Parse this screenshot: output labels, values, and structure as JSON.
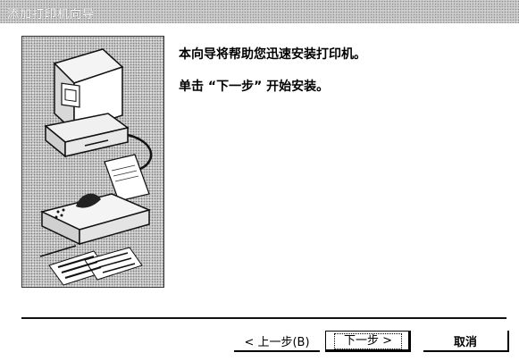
{
  "window": {
    "title": "添加打印机向导"
  },
  "content": {
    "line1": "本向导将帮助您迅速安装打印机。",
    "line2": "单击 “下一步” 开始安装。"
  },
  "buttons": {
    "back_label": "< 上一步(B)",
    "next_label": "下一步 >",
    "cancel_label": "取消"
  },
  "illustration": {
    "icon": "computer-printer-illustration-icon"
  },
  "colors": {
    "background": "#ffffff",
    "titlebar": "#c9c9c9",
    "text": "#000000"
  }
}
